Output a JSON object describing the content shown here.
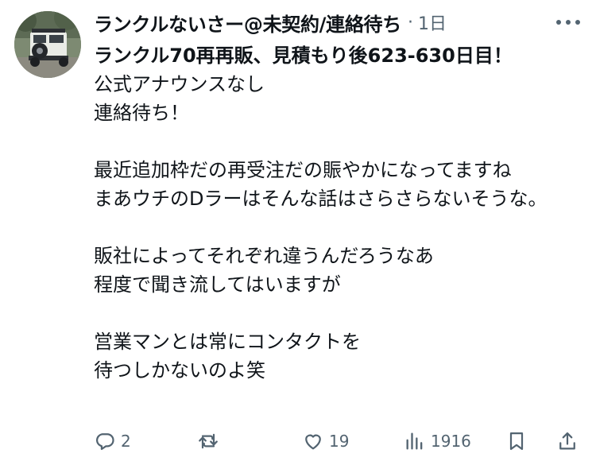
{
  "tweet": {
    "display_name": "ランクルないさー@未契約/連絡待ち",
    "separator": "·",
    "time": "1日",
    "lines": [
      "ランクル70再再販、見積もり後623-630日目！",
      "公式アナウンスなし",
      "連絡待ち！",
      "",
      "最近追加枠だの再受注だの賑やかになってますね",
      "まあウチのDラーはそんな話はさらさらないそうな。",
      "",
      "販社によってそれぞれ違うんだろうなあ",
      "程度で聞き流してはいますが",
      "",
      "営業マンとは常にコンタクトを",
      "待つしかないのよ笑"
    ]
  },
  "actions": {
    "reply_count": "2",
    "retweet_count": "",
    "like_count": "19",
    "views_count": "1916"
  },
  "icons": {
    "more": "more-icon",
    "reply": "reply-icon",
    "retweet": "retweet-icon",
    "like": "heart-icon",
    "views": "views-icon",
    "bookmark": "bookmark-icon",
    "share": "share-icon"
  },
  "colors": {
    "text": "#0f1419",
    "secondary": "#536471",
    "background": "#ffffff"
  }
}
